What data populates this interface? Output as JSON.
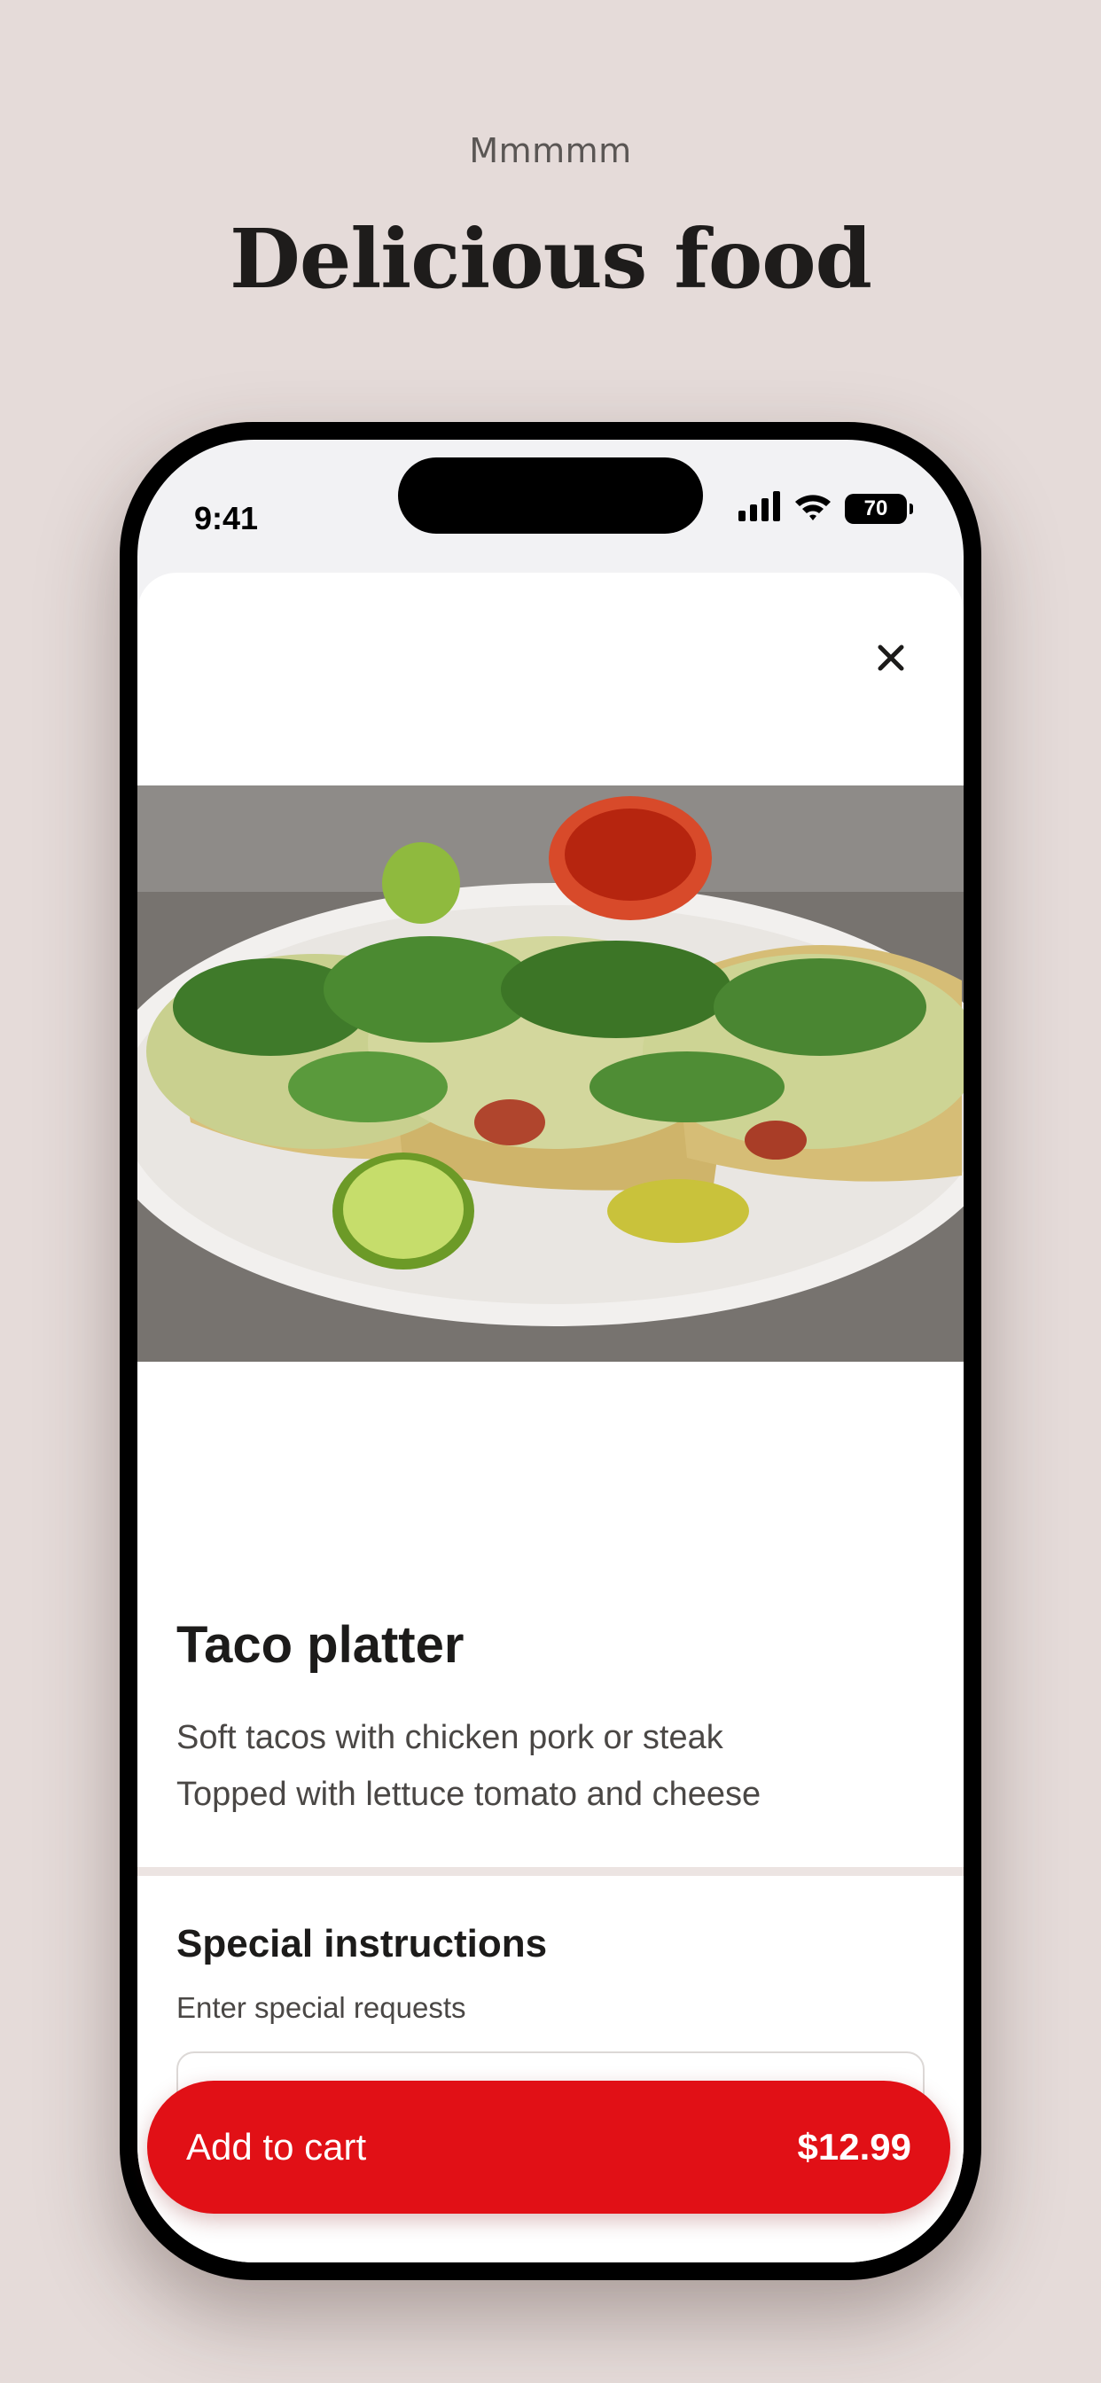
{
  "header": {
    "eyebrow": "Mmmmm",
    "title": "Delicious food"
  },
  "status_bar": {
    "time": "9:41",
    "battery": "70"
  },
  "item": {
    "name": "Taco platter",
    "description": [
      "Soft tacos with chicken pork or steak",
      "Topped with lettuce tomato and cheese"
    ]
  },
  "special_instructions": {
    "title": "Special instructions",
    "subtitle": "Enter special requests",
    "value": ""
  },
  "cart": {
    "label": "Add to cart",
    "price": "$12.99"
  },
  "colors": {
    "background": "#e5dbd9",
    "accent": "#e11016",
    "text": "#1c1b1a"
  },
  "icons": {
    "close": "close-icon",
    "signal": "cellular-signal-icon",
    "wifi": "wifi-icon",
    "battery": "battery-icon"
  }
}
